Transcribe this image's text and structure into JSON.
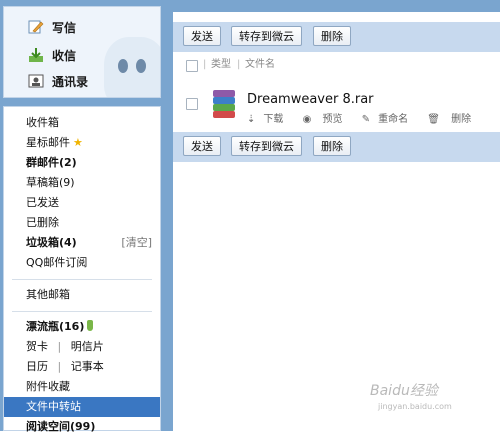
{
  "compose": {
    "write": "写信",
    "receive": "收信",
    "contacts": "通讯录"
  },
  "nav": {
    "inbox": "收件箱",
    "starred": "星标邮件",
    "group": "群邮件(2)",
    "drafts": "草稿箱(9)",
    "sent": "已发送",
    "deleted": "已删除",
    "junk": "垃圾箱(4)",
    "junk_clear": "[清空]",
    "qq_subscribe": "QQ邮件订阅",
    "other_mailbox": "其他邮箱",
    "drift_bottle": "漂流瓶(16)",
    "greeting_card": "贺卡",
    "postcard": "明信片",
    "calendar": "日历",
    "notepad": "记事本",
    "attachments": "附件收藏",
    "file_transfer": "文件中转站",
    "reading_space": "阅读空间(99)",
    "sep": "|"
  },
  "toolbar": {
    "send": "发送",
    "save_weiyun": "转存到微云",
    "delete": "删除"
  },
  "header": {
    "type": "类型",
    "filename": "文件名",
    "sep": "|"
  },
  "file": {
    "name": "Dreamweaver 8.rar",
    "download": "下载",
    "preview": "预览",
    "rename": "重命名",
    "remove": "删除"
  },
  "watermark": {
    "brand": "Baidu经验",
    "url": "jingyan.baidu.com"
  },
  "colors": {
    "frame": "#7aa5cf",
    "toolbar": "#c7d9ee",
    "active": "#3a77c2"
  }
}
